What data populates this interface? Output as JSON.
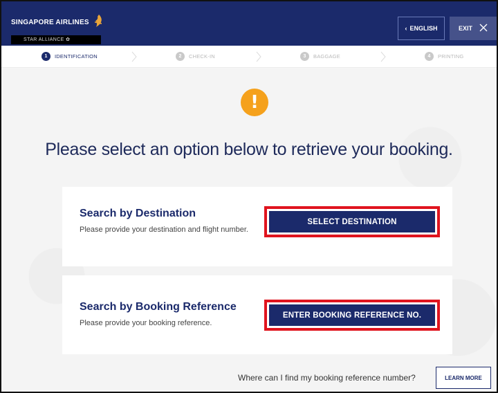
{
  "header": {
    "brand": "SINGAPORE AIRLINES",
    "alliance": "STAR ALLIANCE",
    "language_label": "ENGLISH",
    "exit_label": "EXIT",
    "colors": {
      "navy": "#1b2a6b",
      "gold": "#e9a53a",
      "alert": "#f5a11c",
      "highlight": "#e0141e"
    }
  },
  "steps": [
    {
      "number": "1",
      "label": "IDENTIFICATION",
      "state": "active"
    },
    {
      "number": "2",
      "label": "CHECK-IN",
      "state": "inactive"
    },
    {
      "number": "3",
      "label": "BAGGAGE",
      "state": "inactive"
    },
    {
      "number": "4",
      "label": "PRINTING",
      "state": "inactive"
    }
  ],
  "main": {
    "alert_glyph": "!",
    "heading": "Please select an option below to retrieve your booking.",
    "options": [
      {
        "title": "Search by Destination",
        "description": "Please provide your destination and flight number.",
        "button_label": "SELECT DESTINATION"
      },
      {
        "title": "Search by Booking Reference",
        "description": "Please provide your booking reference.",
        "button_label": "ENTER BOOKING REFERENCE NO."
      }
    ],
    "help_text": "Where can I find my booking reference number?",
    "learn_more_label": "LEARN MORE"
  }
}
